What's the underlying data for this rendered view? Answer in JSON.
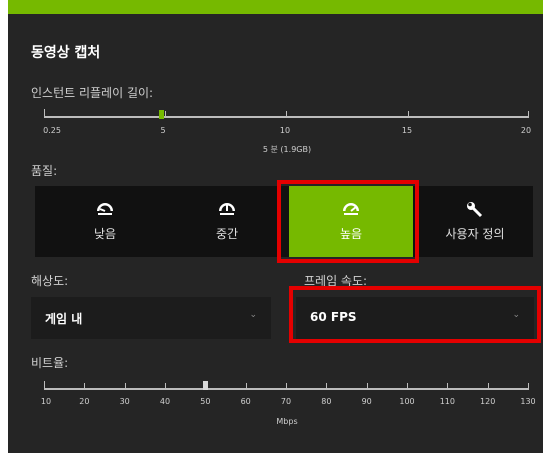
{
  "section_title": "동영상 캡처",
  "replay": {
    "label": "인스턴트 리플레이 길이:",
    "ticks": [
      "0.25",
      "5",
      "10",
      "15",
      "20"
    ],
    "value_label": "5 분 (1.9GB)",
    "value": 5
  },
  "quality": {
    "label": "품질:",
    "options": [
      {
        "label": "낮음",
        "icon": "gauge-low-icon"
      },
      {
        "label": "중간",
        "icon": "gauge-medium-icon"
      },
      {
        "label": "높음",
        "icon": "gauge-high-icon"
      },
      {
        "label": "사용자 정의",
        "icon": "wrench-icon"
      }
    ],
    "selected": "높음"
  },
  "resolution": {
    "label": "해상도:",
    "value": "게임 내"
  },
  "framerate": {
    "label": "프레임 속도:",
    "value": "60 FPS"
  },
  "bitrate": {
    "label": "비트율:",
    "ticks": [
      "10",
      "20",
      "30",
      "40",
      "50",
      "60",
      "70",
      "80",
      "90",
      "100",
      "110",
      "120",
      "130"
    ],
    "unit": "Mbps",
    "value": 50
  },
  "colors": {
    "accent": "#76b900",
    "highlight": "#e40000",
    "panel": "#252525"
  }
}
